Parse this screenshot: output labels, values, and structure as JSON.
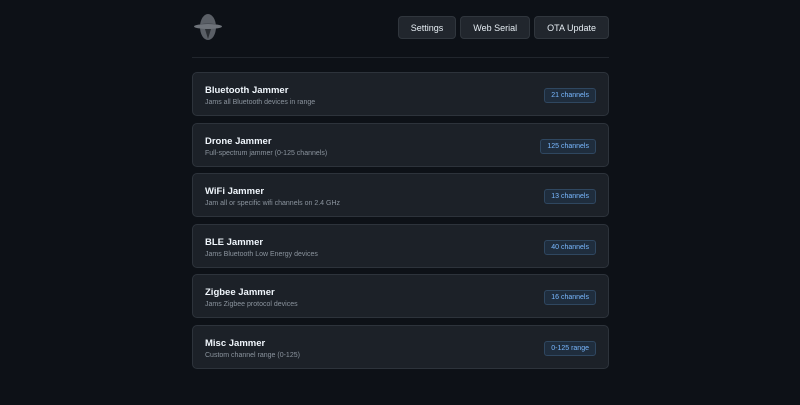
{
  "nav": {
    "settings_label": "Settings",
    "web_serial_label": "Web Serial",
    "ota_update_label": "OTA Update"
  },
  "jammers": [
    {
      "title": "Bluetooth Jammer",
      "description": "Jams all Bluetooth devices in range",
      "badge": "21 channels"
    },
    {
      "title": "Drone Jammer",
      "description": "Full-spectrum jammer (0-125 channels)",
      "badge": "125 channels"
    },
    {
      "title": "WiFi Jammer",
      "description": "Jam all or specific wifi channels on 2.4 GHz",
      "badge": "13 channels"
    },
    {
      "title": "BLE Jammer",
      "description": "Jams Bluetooth Low Energy devices",
      "badge": "40 channels"
    },
    {
      "title": "Zigbee Jammer",
      "description": "Jams Zigbee protocol devices",
      "badge": "16 channels"
    },
    {
      "title": "Misc Jammer",
      "description": "Custom channel range (0-125)",
      "badge": "0-125 range"
    }
  ],
  "colors": {
    "background": "#0d1117",
    "card": "#1c2128",
    "badge_text": "#79b8ff"
  }
}
